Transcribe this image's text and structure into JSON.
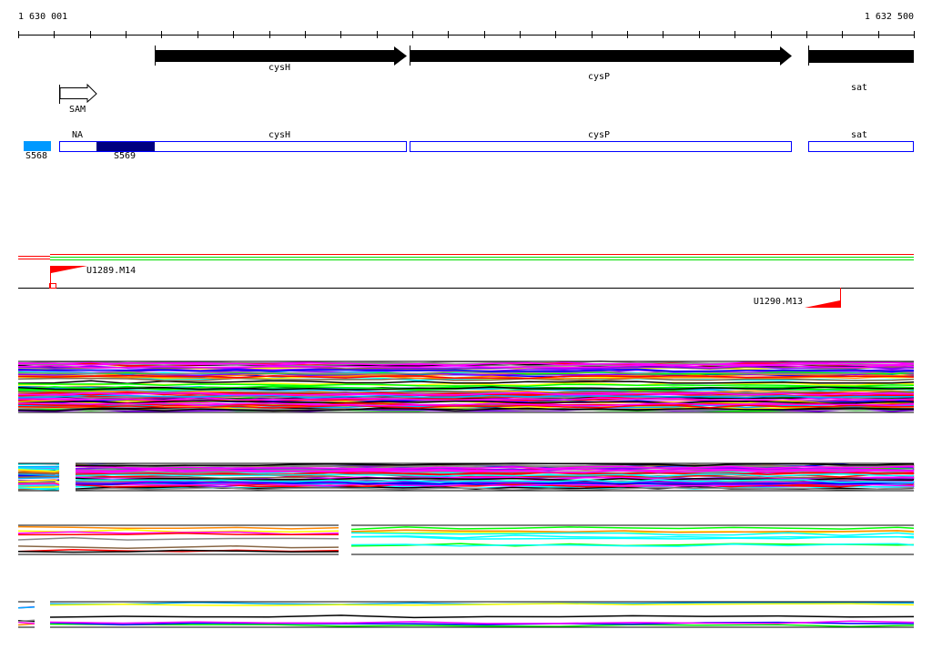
{
  "axis": {
    "start_label": "1 630 001",
    "end_label": "1 632 500",
    "tick_count": 25
  },
  "genes": [
    {
      "name": "cysH",
      "strand": "+"
    },
    {
      "name": "cysP",
      "strand": "+"
    },
    {
      "name": "sat",
      "strand": "+"
    }
  ],
  "sam": {
    "label": "SAM"
  },
  "segments": {
    "s568": "S568",
    "s569": "S569",
    "na": "NA",
    "cysH": "cysH",
    "cysP": "cysP",
    "sat": "sat"
  },
  "markers": {
    "u1289": "U1289.M14",
    "u1290": "U1290.M13"
  },
  "colors": {
    "gene": "#000000",
    "segment_outline": "#0000ff",
    "segment_dark": "#000080",
    "segment_light": "#0099ff",
    "marker": "#ff0000",
    "green": "#00dd00",
    "trace_palette": [
      "#ff00ff",
      "#00ffff",
      "#ffff00",
      "#ff8800",
      "#00ff00",
      "#0000ff",
      "#ff0000",
      "#888888",
      "#8800ff",
      "#000000",
      "#886644",
      "#00aaff"
    ]
  }
}
